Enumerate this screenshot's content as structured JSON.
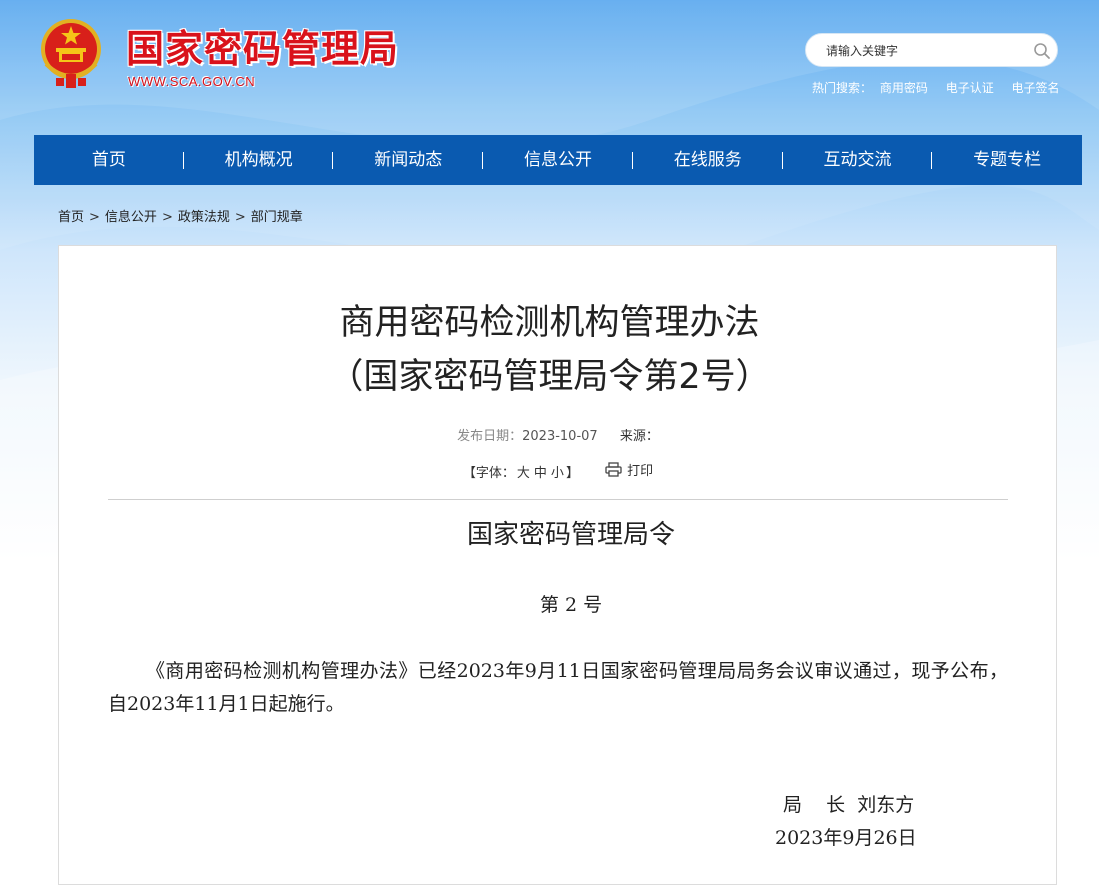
{
  "header": {
    "site_title": "国家密码管理局",
    "site_url": "WWW.SCA.GOV.CN",
    "search_placeholder": "请输入关键字",
    "hot_label": "热门搜索：",
    "hot_links": [
      "商用密码",
      "电子认证",
      "电子签名"
    ]
  },
  "nav": {
    "items": [
      "首页",
      "机构概况",
      "新闻动态",
      "信息公开",
      "在线服务",
      "互动交流",
      "专题专栏"
    ]
  },
  "breadcrumb": {
    "items": [
      "首页",
      "信息公开",
      "政策法规",
      "部门规章"
    ],
    "separator": ">"
  },
  "article": {
    "title_line1": "商用密码检测机构管理办法",
    "title_line2": "（国家密码管理局令第2号）",
    "date_label": "发布日期：",
    "date": "2023-10-07",
    "source_label": "来源：",
    "font_label_open": "【字体：",
    "font_large": "大",
    "font_medium": "中",
    "font_small": "小",
    "font_label_close": "】",
    "print_label": "打印",
    "decree_title": "国家密码管理局令",
    "decree_no": "第 2 号",
    "body": "《商用密码检测机构管理办法》已经2023年9月11日国家密码管理局局务会议审议通过，现予公布，自2023年11月1日起施行。",
    "signer": "局    长  刘东方",
    "sign_date": "2023年9月26日"
  },
  "colors": {
    "brand_red": "#d9121b",
    "nav_blue": "#0a5ab0"
  }
}
